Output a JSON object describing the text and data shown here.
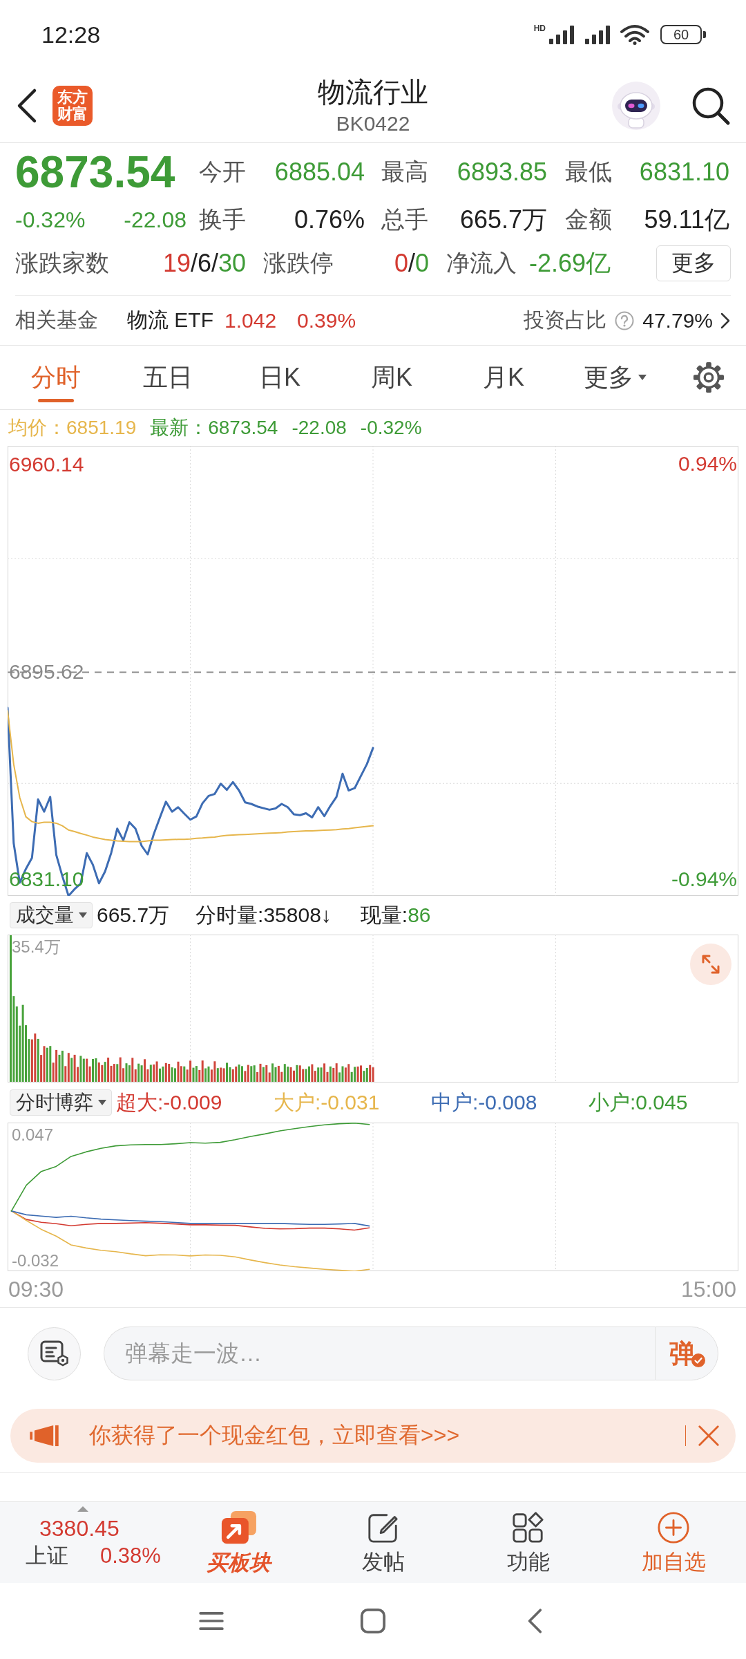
{
  "status_bar": {
    "time": "12:28",
    "network_label": "HD",
    "battery": "60"
  },
  "header": {
    "logo": "东方财富",
    "title": "物流行业",
    "code": "BK0422"
  },
  "quote": {
    "price": {
      "text": "6873.54",
      "color": "#3e9b37"
    },
    "change_pct": {
      "text": "-0.32%",
      "color": "#3e9b37"
    },
    "change": {
      "text": "-22.08",
      "color": "#3e9b37"
    },
    "stats": [
      {
        "label": "今开",
        "value": "6885.04",
        "color": "#3e9b37"
      },
      {
        "label": "最高",
        "value": "6893.85",
        "color": "#3e9b37"
      },
      {
        "label": "最低",
        "value": "6831.10",
        "color": "#3e9b37"
      },
      {
        "label": "换手",
        "value": "0.76%",
        "color": "#222222"
      },
      {
        "label": "总手",
        "value": "665.7万",
        "color": "#222222"
      },
      {
        "label": "金额",
        "value": "59.11亿",
        "color": "#222222"
      }
    ],
    "breadth": [
      {
        "label": "涨跌家数",
        "parts": [
          {
            "text": "19",
            "color": "#d33a31"
          },
          {
            "text": "/6/",
            "color": "#222222"
          },
          {
            "text": "30",
            "color": "#3e9b37"
          }
        ]
      },
      {
        "label": "涨跌停",
        "parts": [
          {
            "text": "0",
            "color": "#d33a31"
          },
          {
            "text": "/",
            "color": "#222222"
          },
          {
            "text": "0",
            "color": "#3e9b37"
          }
        ]
      },
      {
        "label": "净流入",
        "parts": [
          {
            "text": "-2.69亿",
            "color": "#3e9b37"
          }
        ]
      }
    ],
    "more_button": "更多"
  },
  "related_fund": {
    "label": "相关基金",
    "name": "物流 ETF",
    "price": {
      "text": "1.042",
      "color": "#d33a31"
    },
    "change": {
      "text": "0.39%",
      "color": "#d33a31"
    },
    "ratio_label": "投资占比",
    "ratio": "47.79%"
  },
  "tabs": [
    {
      "label": "分时",
      "selected": true,
      "kind": "plain"
    },
    {
      "label": "五日",
      "selected": false,
      "kind": "plain"
    },
    {
      "label": "日K",
      "selected": false,
      "kind": "plain"
    },
    {
      "label": "周K",
      "selected": false,
      "kind": "plain"
    },
    {
      "label": "月K",
      "selected": false,
      "kind": "plain"
    },
    {
      "label": "更多",
      "selected": false,
      "kind": "dropdown"
    }
  ],
  "price_chart": {
    "legend": [
      {
        "text": "均价：6851.19",
        "color": "#e6b64c"
      },
      {
        "text": "最新：6873.54",
        "color": "#3e9b37"
      },
      {
        "text": "-22.08",
        "color": "#3e9b37"
      },
      {
        "text": "-0.32%",
        "color": "#3e9b37"
      }
    ],
    "right_axis_labels": [
      {
        "text": "0.94%",
        "color": "#d33a31"
      },
      {
        "text": "-0.94%",
        "color": "#3e9b37"
      }
    ],
    "chart_data": {
      "type": "line",
      "grid": true,
      "categories": [
        null,
        null,
        null,
        null,
        null,
        null,
        null,
        null,
        null,
        null,
        null,
        null,
        null,
        null,
        null,
        null,
        null,
        null,
        null,
        null,
        null,
        null,
        null,
        null,
        null,
        null,
        null,
        null,
        null,
        null,
        null,
        null,
        null,
        null,
        null,
        null,
        null,
        null,
        null,
        null,
        null,
        null,
        null,
        null,
        null,
        null,
        null,
        null,
        null,
        null,
        null,
        null,
        null,
        null,
        null,
        null,
        null,
        null,
        null,
        null,
        null,
        null,
        null,
        null,
        null,
        null,
        null,
        null,
        null,
        null,
        null,
        null,
        null,
        null,
        null,
        null,
        null,
        null,
        null,
        null,
        null,
        null,
        null,
        null,
        null,
        null,
        null,
        null,
        null,
        null,
        null,
        null,
        null,
        null,
        null,
        null,
        null,
        null,
        null,
        null,
        null,
        null,
        null,
        null,
        null,
        null,
        null,
        null,
        null,
        null,
        null,
        null,
        null,
        null,
        null,
        null,
        null,
        null,
        null,
        null,
        null
      ],
      "ylim": [
        6826,
        6966
      ],
      "yticks": [
        {
          "value": 6960.14,
          "label": "6960.14"
        },
        {
          "value": 6895.62,
          "label": "6895.62"
        },
        {
          "value": 6831.1,
          "label": "6831.10"
        }
      ],
      "series": [
        {
          "color": "#3d6cb3",
          "values": [
            6884.5,
            6842.4,
            6830.1,
            6834.4,
            6837.8,
            6856.0,
            6852.2,
            6856.8,
            6838.7,
            6832.1,
            6826.0,
            6828.1,
            6829.8,
            6839.3,
            6835.7,
            6829.9,
            6833.6,
            6839.3,
            6846.9,
            6843.3,
            6848.9,
            6846.9,
            6841.6,
            6838.9,
            6845.2,
            6850.3,
            6855.3,
            6852.2,
            6853.6,
            6851.6,
            6849.7,
            6850.7,
            6854.8,
            6857.1,
            6857.7,
            6860.9,
            6859.0,
            6861.4,
            6858.8,
            6855.1,
            6854.6,
            6853.8,
            6853.3,
            6852.8,
            6853.2,
            6854.6,
            6853.6,
            6851.4,
            6851.1,
            6851.7,
            6850.4,
            6853.6,
            6850.8,
            6854.0,
            6856.8,
            6864.0,
            6858.8,
            6859.5,
            6863.3,
            6867.0,
            6872.0,
            null,
            null,
            null,
            null,
            null,
            null,
            null,
            null,
            null,
            null,
            null,
            null,
            null,
            null,
            null,
            null,
            null,
            null,
            null,
            null,
            null,
            null,
            null,
            null,
            null,
            null,
            null,
            null,
            null,
            null,
            null,
            null,
            null,
            null,
            null,
            null,
            null,
            null,
            null,
            null,
            null,
            null,
            null,
            null,
            null,
            null,
            null,
            null,
            null,
            null,
            null,
            null,
            null,
            null,
            null,
            null,
            null,
            null,
            null,
            null
          ]
        },
        {
          "color": "#e6b64c",
          "values": [
            6883.6,
            6867.0,
            6856.6,
            6850.6,
            6849.1,
            6848.6,
            6848.9,
            6848.9,
            6848.6,
            6847.8,
            6846.5,
            6846.0,
            6845.4,
            6844.9,
            6844.3,
            6843.9,
            6843.5,
            6843.3,
            6843.1,
            6843.0,
            6842.9,
            6842.9,
            6842.9,
            6843.1,
            6843.3,
            6843.3,
            6843.4,
            6843.5,
            6843.6,
            6843.6,
            6843.7,
            6843.9,
            6844.0,
            6844.2,
            6844.3,
            6844.6,
            6844.8,
            6844.9,
            6845.0,
            6845.1,
            6845.2,
            6845.3,
            6845.4,
            6845.5,
            6845.6,
            6845.7,
            6845.9,
            6846.0,
            6846.1,
            6846.2,
            6846.2,
            6846.3,
            6846.4,
            6846.5,
            6846.6,
            6846.8,
            6846.9,
            6847.2,
            6847.4,
            6847.6,
            6847.8,
            null,
            null,
            null,
            null,
            null,
            null,
            null,
            null,
            null,
            null,
            null,
            null,
            null,
            null,
            null,
            null,
            null,
            null,
            null,
            null,
            null,
            null,
            null,
            null,
            null,
            null,
            null,
            null,
            null,
            null,
            null,
            null,
            null,
            null,
            null,
            null,
            null,
            null,
            null,
            null,
            null,
            null,
            null,
            null,
            null,
            null,
            null,
            null,
            null,
            null,
            null,
            null,
            null,
            null,
            null,
            null,
            null,
            null,
            null,
            null
          ]
        },
        {
          "color": "#8c8c8c",
          "line_style": "dashed",
          "values": [
            6895.6,
            6895.6,
            6895.6,
            6895.6,
            6895.6,
            6895.6,
            6895.6,
            6895.6,
            6895.6,
            6895.6,
            6895.6,
            6895.6,
            6895.6,
            6895.6,
            6895.6,
            6895.6,
            6895.6,
            6895.6,
            6895.6,
            6895.6,
            6895.6,
            6895.6,
            6895.6,
            6895.6,
            6895.6,
            6895.6,
            6895.6,
            6895.6,
            6895.6,
            6895.6,
            6895.6,
            6895.6,
            6895.6,
            6895.6,
            6895.6,
            6895.6,
            6895.6,
            6895.6,
            6895.6,
            6895.6,
            6895.6,
            6895.6,
            6895.6,
            6895.6,
            6895.6,
            6895.6,
            6895.6,
            6895.6,
            6895.6,
            6895.6,
            6895.6,
            6895.6,
            6895.6,
            6895.6,
            6895.6,
            6895.6,
            6895.6,
            6895.6,
            6895.6,
            6895.6,
            6895.6,
            6895.6,
            6895.6,
            6895.6,
            6895.6,
            6895.6,
            6895.6,
            6895.6,
            6895.6,
            6895.6,
            6895.6,
            6895.6,
            6895.6,
            6895.6,
            6895.6,
            6895.6,
            6895.6,
            6895.6,
            6895.6,
            6895.6,
            6895.6,
            6895.6,
            6895.6,
            6895.6,
            6895.6,
            6895.6,
            6895.6,
            6895.6,
            6895.6,
            6895.6,
            6895.6,
            6895.6,
            6895.6,
            6895.6,
            6895.6,
            6895.6,
            6895.6,
            6895.6,
            6895.6,
            6895.6,
            6895.6,
            6895.6,
            6895.6,
            6895.6,
            6895.6,
            6895.6,
            6895.6,
            6895.6,
            6895.6,
            6895.6,
            6895.6,
            6895.6,
            6895.6,
            6895.6,
            6895.6,
            6895.6,
            6895.6,
            6895.6,
            6895.6,
            6895.6,
            6895.6
          ]
        }
      ]
    }
  },
  "volume": {
    "selector": "成交量",
    "total": "665.7万",
    "minute_volume": "分时量:35808↓",
    "current_label": "现量:",
    "current_value": {
      "text": "86",
      "color": "#3e9b37"
    },
    "max_label": "35.4万"
  },
  "flow": {
    "selector": "分时博弈",
    "legend": [
      {
        "text": "超大:-0.009",
        "color": "#d33a31"
      },
      {
        "text": "大户:-0.031",
        "color": "#e6b64c"
      },
      {
        "text": "中户:-0.008",
        "color": "#3d6cb3"
      },
      {
        "text": "小户:0.045",
        "color": "#3e9b37"
      }
    ],
    "chart_data": {
      "type": "line",
      "grid": true,
      "categories": [
        null,
        null,
        null,
        null,
        null,
        null,
        null,
        null,
        null,
        null,
        null,
        null,
        null,
        null,
        null,
        null,
        null,
        null,
        null,
        null,
        null,
        null,
        null,
        null,
        null,
        null,
        null,
        null,
        null,
        null,
        null,
        null,
        null,
        null,
        null,
        null,
        null,
        null,
        null,
        null,
        null,
        null,
        null,
        null,
        null,
        null,
        null,
        null,
        null
      ],
      "ylim": [
        -0.0385,
        0.0548
      ],
      "yticks": [
        {
          "value": 0.047,
          "label": "0.047"
        },
        {
          "value": -0.032,
          "label": "-0.032"
        }
      ],
      "series": [
        {
          "color": "#d33a31",
          "values": [
            -0.0007,
            -0.006,
            -0.0078,
            -0.0087,
            -0.01,
            -0.0091,
            -0.0085,
            -0.0085,
            -0.0083,
            -0.008,
            -0.0084,
            -0.0088,
            -0.0094,
            -0.0094,
            -0.0096,
            -0.0097,
            -0.0107,
            -0.0116,
            -0.0119,
            -0.0118,
            -0.0114,
            -0.0114,
            -0.0119,
            -0.0127,
            -0.0113,
            null,
            null,
            null,
            null,
            null,
            null,
            null,
            null,
            null,
            null,
            null,
            null,
            null,
            null,
            null,
            null,
            null,
            null,
            null,
            null,
            null,
            null,
            null,
            null
          ]
        },
        {
          "color": "#e6b64c",
          "values": [
            -0.0007,
            -0.0066,
            -0.0122,
            -0.0165,
            -0.022,
            -0.0239,
            -0.0254,
            -0.0262,
            -0.0276,
            -0.0288,
            -0.0282,
            -0.0283,
            -0.0289,
            -0.0283,
            -0.0285,
            -0.0295,
            -0.0314,
            -0.0331,
            -0.0346,
            -0.0357,
            -0.0365,
            -0.0373,
            -0.0379,
            -0.0385,
            -0.0373,
            null,
            null,
            null,
            null,
            null,
            null,
            null,
            null,
            null,
            null,
            null,
            null,
            null,
            null,
            null,
            null,
            null,
            null,
            null,
            null,
            null,
            null,
            null,
            null
          ]
        },
        {
          "color": "#3d6cb3",
          "values": [
            -0.0007,
            -0.0031,
            -0.0039,
            -0.0047,
            -0.004,
            -0.005,
            -0.0058,
            -0.0063,
            -0.0067,
            -0.0071,
            -0.0074,
            -0.0079,
            -0.0085,
            -0.0085,
            -0.0085,
            -0.0085,
            -0.0085,
            -0.0085,
            -0.0085,
            -0.0088,
            -0.0091,
            -0.0091,
            -0.0088,
            -0.0085,
            -0.0101,
            null,
            null,
            null,
            null,
            null,
            null,
            null,
            null,
            null,
            null,
            null,
            null,
            null,
            null,
            null,
            null,
            null,
            null,
            null,
            null,
            null,
            null,
            null,
            null
          ]
        },
        {
          "color": "#3e9b37",
          "values": [
            -0.0007,
            0.0155,
            0.0241,
            0.0273,
            0.0336,
            0.0364,
            0.0386,
            0.0402,
            0.0408,
            0.041,
            0.041,
            0.0415,
            0.0422,
            0.0419,
            0.0424,
            0.0441,
            0.046,
            0.0477,
            0.0496,
            0.051,
            0.0523,
            0.0534,
            0.0541,
            0.0545,
            0.0536,
            null,
            null,
            null,
            null,
            null,
            null,
            null,
            null,
            null,
            null,
            null,
            null,
            null,
            null,
            null,
            null,
            null,
            null,
            null,
            null,
            null,
            null,
            null,
            null
          ]
        }
      ]
    }
  },
  "time_axis": [
    "09:30",
    "15:00"
  ],
  "danmu": {
    "placeholder": "弹幕走一波…",
    "send": "弹"
  },
  "banner": {
    "text": "你获得了一个现金红包，立即查看>>>"
  },
  "bottom_nav": {
    "index": {
      "value": {
        "text": "3380.45",
        "color": "#d33a31"
      },
      "name": "上证",
      "change": {
        "text": "0.38%",
        "color": "#d33a31"
      }
    },
    "items": [
      {
        "label": "买板块",
        "kind": "brand"
      },
      {
        "label": "发帖",
        "kind": "post"
      },
      {
        "label": "功能",
        "kind": "apps"
      },
      {
        "label": "加自选",
        "kind": "add"
      }
    ]
  }
}
